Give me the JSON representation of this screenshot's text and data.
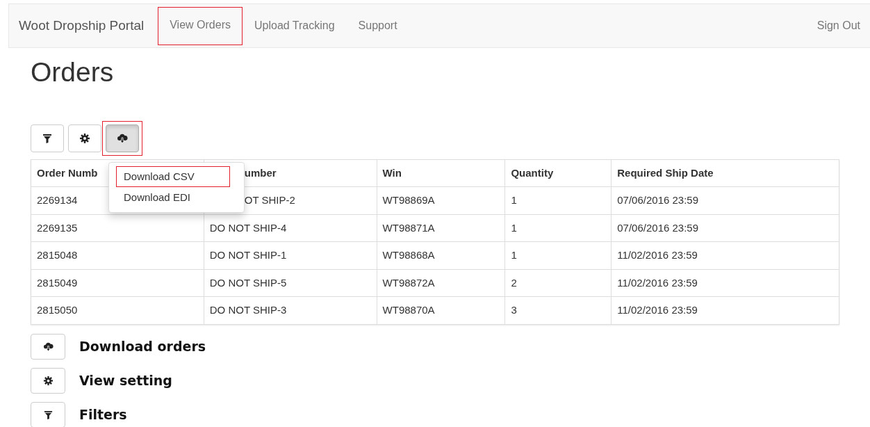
{
  "navbar": {
    "brand": "Woot Dropship Portal",
    "items": [
      {
        "label": "View Orders",
        "highlighted": true
      },
      {
        "label": "Upload Tracking",
        "highlighted": false
      },
      {
        "label": "Support",
        "highlighted": false
      }
    ],
    "sign_out": "Sign Out"
  },
  "page_title": "Orders",
  "toolbar": {
    "buttons": [
      {
        "kind": "filter",
        "active": false,
        "highlighted": false
      },
      {
        "kind": "settings",
        "active": false,
        "highlighted": false
      },
      {
        "kind": "download",
        "active": true,
        "highlighted": true
      }
    ]
  },
  "dropdown": {
    "items": [
      {
        "label": "Download CSV",
        "highlighted": true
      },
      {
        "label": "Download EDI",
        "highlighted": false
      }
    ]
  },
  "table": {
    "columns": [
      "Order Numb",
      "umber",
      "Win",
      "Quantity",
      "Required Ship Date"
    ],
    "rows": [
      [
        "2269134",
        "OT SHIP-2",
        "WT98869A",
        "1",
        "07/06/2016 23:59"
      ],
      [
        "2269135",
        "DO NOT SHIP-4",
        "WT98871A",
        "1",
        "07/06/2016 23:59"
      ],
      [
        "2815048",
        "DO NOT SHIP-1",
        "WT98868A",
        "1",
        "11/02/2016 23:59"
      ],
      [
        "2815049",
        "DO NOT SHIP-5",
        "WT98872A",
        "2",
        "11/02/2016 23:59"
      ],
      [
        "2815050",
        "DO NOT SHIP-3",
        "WT98870A",
        "3",
        "11/02/2016 23:59"
      ]
    ]
  },
  "legend": [
    {
      "kind": "download",
      "label": "Download orders"
    },
    {
      "kind": "settings",
      "label": "View setting"
    },
    {
      "kind": "filter",
      "label": "Filters"
    }
  ]
}
